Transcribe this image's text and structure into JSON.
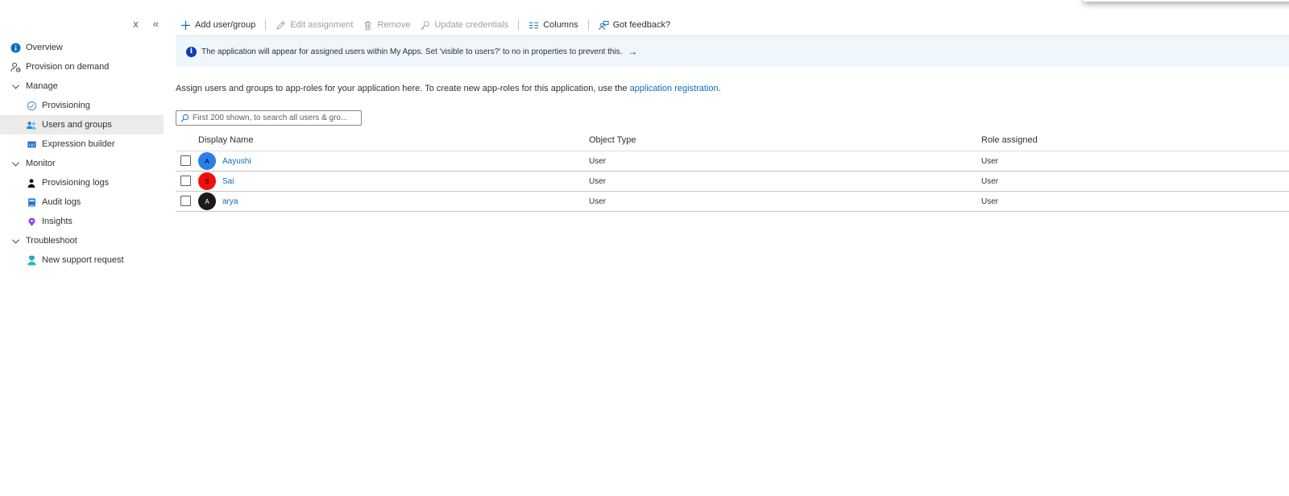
{
  "sidebar": {
    "close_glyph": "x",
    "collapse_glyph": "«",
    "items": [
      {
        "label": "Overview",
        "icon": "info-icon",
        "level": 0
      },
      {
        "label": "Provision on demand",
        "icon": "person-provision-icon",
        "level": 0
      },
      {
        "label": "Manage",
        "icon": "chevron-down-icon",
        "level": 0,
        "group": true
      },
      {
        "label": "Provisioning",
        "icon": "provisioning-icon",
        "level": 1
      },
      {
        "label": "Users and groups",
        "icon": "users-icon",
        "level": 1,
        "selected": true
      },
      {
        "label": "Expression builder",
        "icon": "expression-icon",
        "level": 1
      },
      {
        "label": "Monitor",
        "icon": "chevron-down-icon",
        "level": 0,
        "group": true
      },
      {
        "label": "Provisioning logs",
        "icon": "logs-person-icon",
        "level": 1
      },
      {
        "label": "Audit logs",
        "icon": "audit-book-icon",
        "level": 1
      },
      {
        "label": "Insights",
        "icon": "insights-icon",
        "level": 1
      },
      {
        "label": "Troubleshoot",
        "icon": "chevron-down-icon",
        "level": 0,
        "group": true
      },
      {
        "label": "New support request",
        "icon": "support-person-icon",
        "level": 1
      }
    ]
  },
  "toolbar": {
    "add": "Add user/group",
    "edit": "Edit assignment",
    "remove": "Remove",
    "update": "Update credentials",
    "columns": "Columns",
    "feedback": "Got feedback?"
  },
  "banner": {
    "text": "The application will appear for assigned users within My Apps. Set 'visible to users?' to no in properties to prevent this.",
    "arrow": "→"
  },
  "description": {
    "text": "Assign users and groups to app-roles for your application here. To create new app-roles for this application, use the ",
    "link": "application registration",
    "suffix": "."
  },
  "search": {
    "placeholder": "First 200 shown, to search all users & gro..."
  },
  "table": {
    "headers": {
      "name": "Display Name",
      "type": "Object Type",
      "role": "Role assigned"
    },
    "rows": [
      {
        "initial": "A",
        "name": "Aayushi",
        "type": "User",
        "role": "User",
        "avatar_color": "#2b7de9"
      },
      {
        "initial": "S",
        "name": "Sai",
        "type": "User",
        "role": "User",
        "avatar_color": "#f00f0f"
      },
      {
        "initial": "A",
        "name": "arya",
        "type": "User",
        "role": "User",
        "avatar_color": "#1b1a19"
      }
    ]
  },
  "colors": {
    "accent": "#0f6cbd",
    "banner_bg": "#eff6fc",
    "selected_bg": "#edebe9"
  }
}
